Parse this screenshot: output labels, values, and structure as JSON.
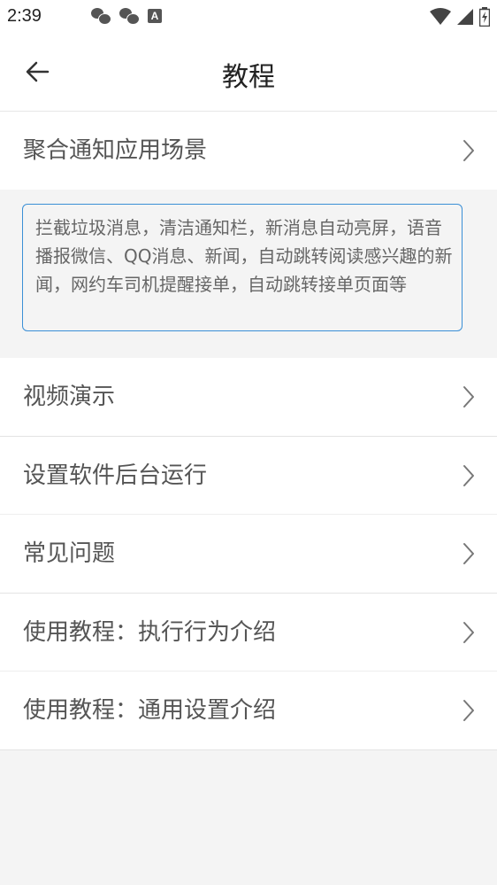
{
  "status_bar": {
    "time": "2:39",
    "left_icons": [
      "wechat-icon",
      "wechat-icon",
      "a-icon"
    ],
    "right_icons": [
      "wifi-icon",
      "signal-icon",
      "battery-icon"
    ]
  },
  "header": {
    "title": "教程",
    "back_icon": "arrow-left-icon"
  },
  "items": [
    {
      "label": "聚合通知应用场景"
    },
    {
      "label": "视频演示"
    },
    {
      "label": "设置软件后台运行"
    },
    {
      "label": "常见问题"
    },
    {
      "label": "使用教程：执行行为介绍"
    },
    {
      "label": "使用教程：通用设置介绍"
    }
  ],
  "description": "拦截垃圾消息，清洁通知栏，新消息自动亮屏，语音播报微信、QQ消息、新闻，自动跳转阅读感兴趣的新闻，网约车司机提醒接单，自动跳转接单页面等",
  "colors": {
    "accent_border": "#3a8fd6",
    "background": "#f4f4f4",
    "row_background": "#ffffff"
  }
}
